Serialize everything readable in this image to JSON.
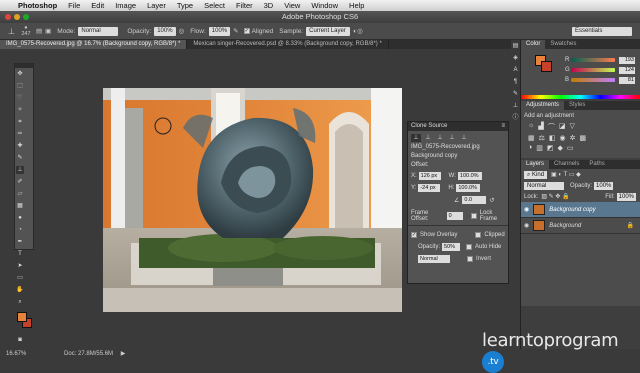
{
  "menubar": {
    "apple": "",
    "app": "Photoshop",
    "items": [
      "File",
      "Edit",
      "Image",
      "Layer",
      "Type",
      "Select",
      "Filter",
      "3D",
      "View",
      "Window",
      "Help"
    ]
  },
  "window": {
    "title": "Adobe Photoshop CS6"
  },
  "options": {
    "brush_size": "247",
    "mode_label": "Mode:",
    "mode_value": "Normal",
    "opacity_label": "Opacity:",
    "opacity_value": "100%",
    "flow_label": "Flow:",
    "flow_value": "100%",
    "aligned_label": "Aligned",
    "sample_label": "Sample:",
    "sample_value": "Current Layer",
    "workspace": "Essentials"
  },
  "tabs": [
    {
      "label": "IMG_0575-Recovered.jpg @ 16.7% (Background copy, RGB/8*) *"
    },
    {
      "label": "Mexican singer-Recovered.psd @ 8.33% (Background copy, RGB/8*) *"
    }
  ],
  "status": {
    "zoom": "16.67%",
    "doc": "Doc: 27.8M/55.6M"
  },
  "colors": {
    "foreground": "#e8823a",
    "background": "#c6402a",
    "accent": "#1a7fd0"
  },
  "color_panel": {
    "tabs": [
      "Color",
      "Swatches"
    ],
    "r": 193,
    "g": 124,
    "b": 81
  },
  "adjustments": {
    "tabs": [
      "Adjustments",
      "Styles"
    ],
    "heading": "Add an adjustment"
  },
  "layers": {
    "tabs": [
      "Layers",
      "Channels",
      "Paths"
    ],
    "kind": "Kind",
    "blend": "Normal",
    "opacity_label": "Opacity:",
    "opacity_value": "100%",
    "lock_label": "Lock:",
    "fill_label": "Fill:",
    "fill_value": "100%",
    "rows": [
      {
        "name": "Background copy",
        "selected": true
      },
      {
        "name": "Background",
        "selected": false
      }
    ]
  },
  "clone_source": {
    "title": "Clone Source",
    "source_name": "IMG_0575-Recovered.jpg",
    "source_layer": "Background copy",
    "offset_label": "Offset:",
    "x_label": "X:",
    "x_value": "126 px",
    "y_label": "Y:",
    "y_value": "-24 px",
    "w_label": "W:",
    "w_value": "100.0%",
    "h_label": "H:",
    "h_value": "100.0%",
    "angle_value": "0.0",
    "frame_offset_label": "Frame Offset:",
    "frame_offset_value": "0",
    "lock_frame": "Lock Frame",
    "show_overlay": "Show Overlay",
    "clipped": "Clipped",
    "overlay_opacity_label": "Opacity:",
    "overlay_opacity_value": "50%",
    "auto_hide": "Auto Hide",
    "overlay_mode": "Normal",
    "invert": "Invert"
  },
  "watermark": {
    "text": "learntoprogram",
    "tv": ".tv"
  }
}
